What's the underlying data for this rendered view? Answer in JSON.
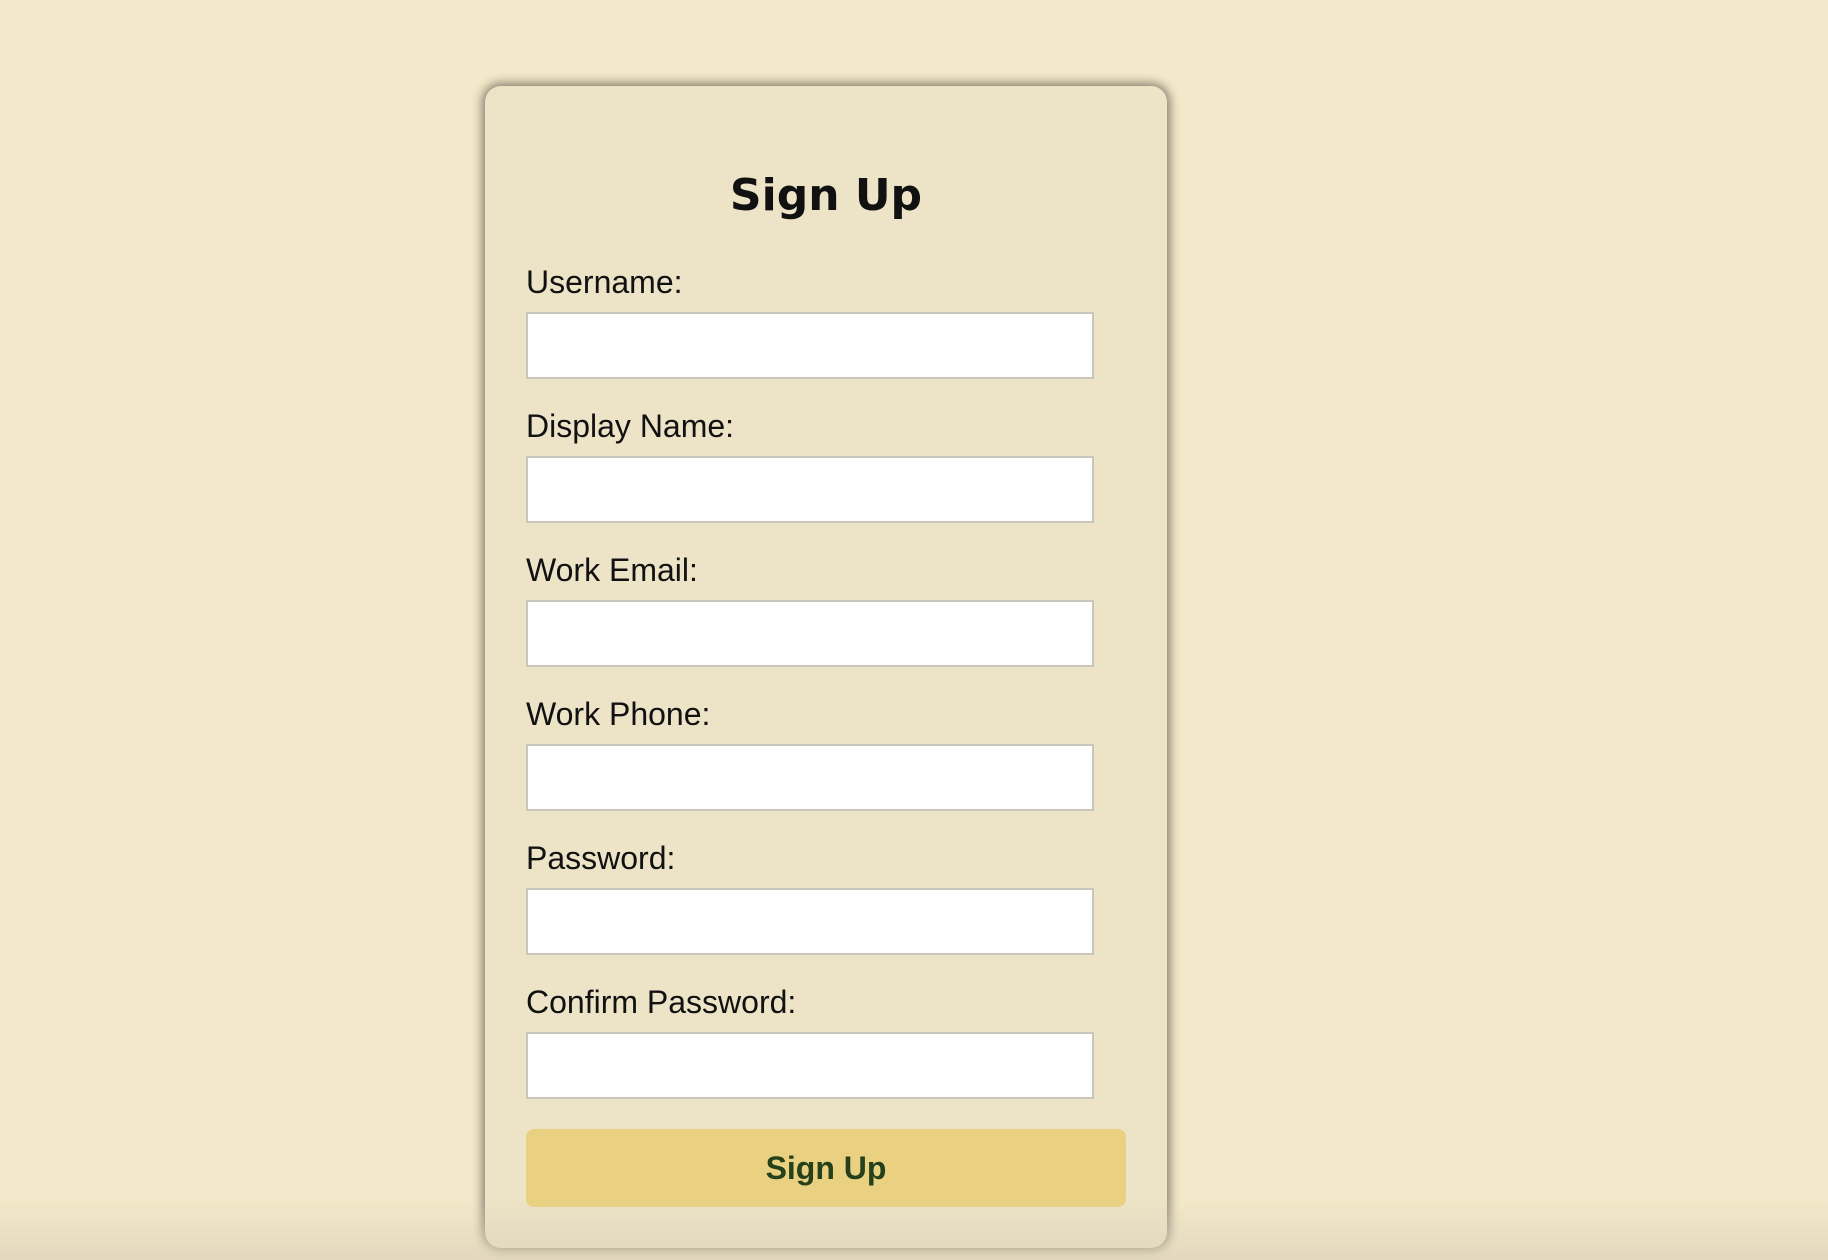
{
  "form": {
    "title": "Sign Up",
    "fields": [
      {
        "label": "Username:",
        "value": "",
        "placeholder": "",
        "type": "text"
      },
      {
        "label": "Display Name:",
        "value": "",
        "placeholder": "",
        "type": "text"
      },
      {
        "label": "Work Email:",
        "value": "",
        "placeholder": "",
        "type": "email"
      },
      {
        "label": "Work Phone:",
        "value": "",
        "placeholder": "",
        "type": "tel"
      },
      {
        "label": "Password:",
        "value": "",
        "placeholder": "",
        "type": "password"
      },
      {
        "label": "Confirm Password:",
        "value": "",
        "placeholder": "",
        "type": "password"
      }
    ],
    "submit_label": "Sign Up"
  },
  "colors": {
    "background": "#f3e8c9",
    "card": "#ede3c7",
    "button": "#e9d181",
    "button_text": "#25401a"
  }
}
